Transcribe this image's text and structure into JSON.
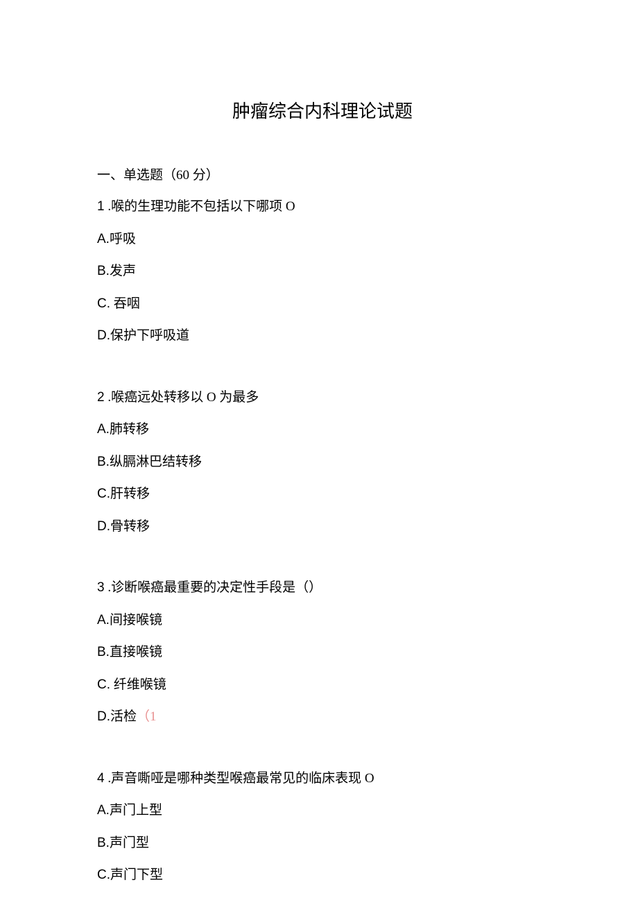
{
  "title": "肿瘤综合内科理论试题",
  "section_heading": "一、单选题（60 分）",
  "questions": [
    {
      "num": "1",
      "text": " .喉的生理功能不包括以下哪项 O",
      "options": [
        {
          "letter": "A.",
          "text": "呼吸"
        },
        {
          "letter": "B.",
          "text": "发声"
        },
        {
          "letter": "C.",
          "text": " 吞咽"
        },
        {
          "letter": "D.",
          "text": "保护下呼吸道"
        }
      ]
    },
    {
      "num": "2",
      "text": "  .喉癌远处转移以 O 为最多",
      "options": [
        {
          "letter": "A.",
          "text": "肺转移"
        },
        {
          "letter": "B.",
          "text": "纵膈淋巴结转移"
        },
        {
          "letter": "C.",
          "text": "肝转移"
        },
        {
          "letter": "D.",
          "text": "骨转移"
        }
      ]
    },
    {
      "num": "3",
      "text": "  .诊断喉癌最重要的决定性手段是（）",
      "options": [
        {
          "letter": "A.",
          "text": "间接喉镜"
        },
        {
          "letter": "B.",
          "text": "直接喉镜"
        },
        {
          "letter": "C.",
          "text": " 纤维喉镜"
        },
        {
          "letter": "D.",
          "text": "活检",
          "highlight": "（1"
        }
      ]
    },
    {
      "num": "4",
      "text": "  .声音嘶哑是哪种类型喉癌最常见的临床表现 O",
      "options": [
        {
          "letter": "A.",
          "text": "声门上型"
        },
        {
          "letter": "B.",
          "text": "声门型"
        },
        {
          "letter": "C.",
          "text": "声门下型"
        }
      ]
    }
  ]
}
